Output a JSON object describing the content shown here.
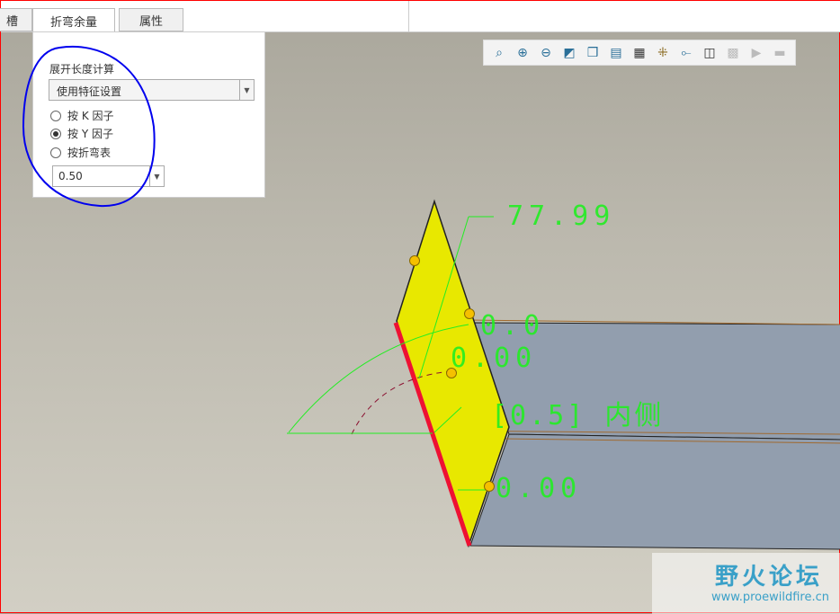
{
  "tabs": [
    {
      "label": "槽"
    },
    {
      "label": "折弯余量"
    },
    {
      "label": "属性"
    }
  ],
  "panel": {
    "section_label": "展开长度计算",
    "dropdown_value": "使用特征设置",
    "radios": [
      {
        "label": "按 K 因子",
        "checked": false
      },
      {
        "label": "按 Y 因子",
        "checked": true
      },
      {
        "label": "按折弯表",
        "checked": false
      }
    ],
    "factor_value": "0.50"
  },
  "toolbar": [
    "zoom-fit",
    "zoom-in",
    "zoom-out",
    "repaint",
    "view-orientation",
    "saved-views",
    "display-style",
    "datum-display",
    "spin-center",
    "annotation-display",
    "disabled-tool",
    "play",
    "disabled-tool2"
  ],
  "dimensions": {
    "d1": "77.99",
    "d2": "0.0",
    "d3": "0.00",
    "d4": "[0.5] 内侧",
    "d5": "0.00"
  },
  "watermark": {
    "title": "野火论坛",
    "url": "www.proewildfire.cn"
  },
  "colors": {
    "flange": "#e8e800",
    "body": "#929eae",
    "edge": "#ee1133",
    "dim": "#22ee22",
    "annotation": "#0000ee"
  }
}
